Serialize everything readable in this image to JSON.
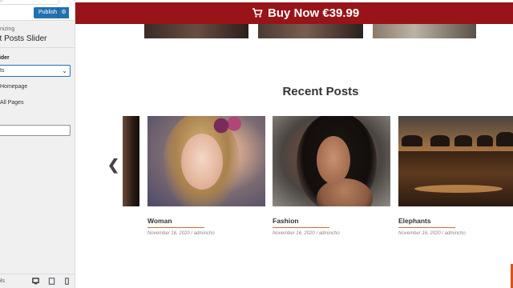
{
  "sidebar": {
    "close_hint": "o",
    "publish_label": "Publish",
    "gear_icon": "gear-icon",
    "breadcrumb": "nizing",
    "section_title": "nt Posts Slider",
    "control_label": "lider",
    "select_value": "ts",
    "option_homepage": "Homepage",
    "option_all_pages": "All Pages",
    "footer_controls_label": "ols",
    "devices": [
      "desktop-icon",
      "tablet-icon",
      "mobile-icon"
    ]
  },
  "buy_bar": {
    "label": "Buy Now €39.99",
    "icon": "cart-icon",
    "color": "#981418"
  },
  "section": {
    "heading": "Recent Posts"
  },
  "posts": [
    {
      "title": "Woman",
      "meta": "November 16, 2020 / admincho"
    },
    {
      "title": "Fashion",
      "meta": "November 16, 2020 / admincho"
    },
    {
      "title": "Elephants",
      "meta": "November 16, 2020 / admincho"
    }
  ],
  "slider": {
    "prev_icon": "chevron-left-icon",
    "next_icon": "chevron-right-icon",
    "prev_glyph": "❮",
    "next_glyph": "❯"
  },
  "colors": {
    "accent": "#2271b1",
    "underline": "#d66a2e"
  }
}
